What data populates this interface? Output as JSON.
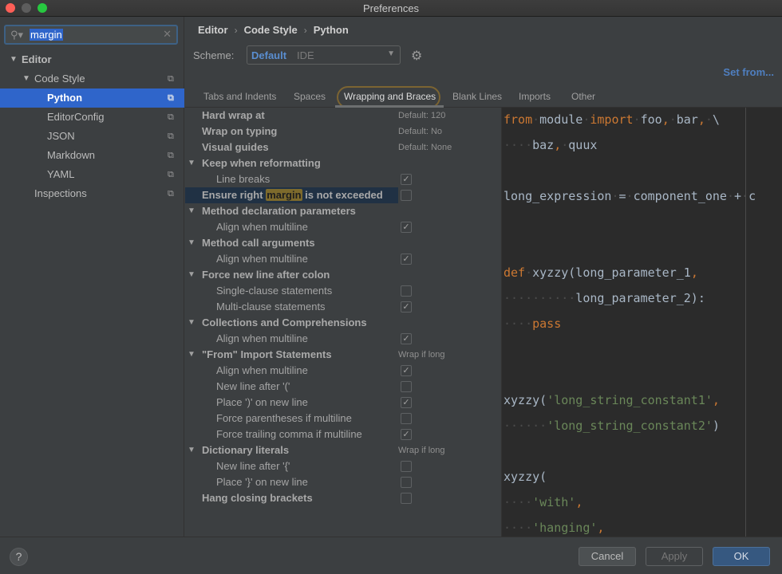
{
  "window": {
    "title": "Preferences"
  },
  "sidebar": {
    "search": {
      "value": "margin",
      "icon": "search-icon",
      "clear_icon": "clear-icon"
    },
    "items": [
      {
        "label": "Editor",
        "level": 0,
        "expanded": true,
        "bold": true
      },
      {
        "label": "Code Style",
        "level": 1,
        "expanded": true
      },
      {
        "label": "Python",
        "level": 2,
        "selected": true
      },
      {
        "label": "EditorConfig",
        "level": 2
      },
      {
        "label": "JSON",
        "level": 2
      },
      {
        "label": "Markdown",
        "level": 2
      },
      {
        "label": "YAML",
        "level": 2
      },
      {
        "label": "Inspections",
        "level": 1
      }
    ]
  },
  "breadcrumb": {
    "items": [
      "Editor",
      "Code Style",
      "Python"
    ],
    "separator": "›"
  },
  "scheme": {
    "label": "Scheme:",
    "name": "Default",
    "sub": "IDE",
    "gear_icon": "gear-icon"
  },
  "set_from": "Set from...",
  "tabs": [
    {
      "label": "Tabs and Indents"
    },
    {
      "label": "Spaces"
    },
    {
      "label": "Wrapping and Braces",
      "active": true
    },
    {
      "label": "Blank Lines"
    },
    {
      "label": "Imports"
    },
    {
      "label": "Other"
    }
  ],
  "settings": {
    "rows": [
      {
        "label": "Hard wrap at",
        "group": true,
        "value": "Default: 120"
      },
      {
        "label": "Wrap on typing",
        "group": true,
        "value": "Default: No"
      },
      {
        "label": "Visual guides",
        "group": true,
        "value": "Default: None"
      },
      {
        "label": "Keep when reformatting",
        "group": true,
        "expandable": true
      },
      {
        "label": "Line breaks",
        "checked": true
      },
      {
        "label_before": "Ensure right ",
        "label_match": "margin",
        "label_after": " is not exceeded",
        "group": true,
        "checked": false,
        "highlighted": true
      },
      {
        "label": "Method declaration parameters",
        "group": true,
        "expandable": true
      },
      {
        "label": "Align when multiline",
        "checked": true
      },
      {
        "label": "Method call arguments",
        "group": true,
        "expandable": true
      },
      {
        "label": "Align when multiline",
        "checked": true
      },
      {
        "label": "Force new line after colon",
        "group": true,
        "expandable": true
      },
      {
        "label": "Single-clause statements",
        "checked": false
      },
      {
        "label": "Multi-clause statements",
        "checked": true
      },
      {
        "label": "Collections and Comprehensions",
        "group": true,
        "expandable": true
      },
      {
        "label": "Align when multiline",
        "checked": true
      },
      {
        "label": "\"From\" Import Statements",
        "group": true,
        "expandable": true,
        "value": "Wrap if long"
      },
      {
        "label": "Align when multiline",
        "checked": true
      },
      {
        "label": "New line after '('",
        "checked": false
      },
      {
        "label": "Place ')' on new line",
        "checked": true
      },
      {
        "label": "Force parentheses if multiline",
        "checked": false
      },
      {
        "label": "Force trailing comma if multiline",
        "checked": true
      },
      {
        "label": "Dictionary literals",
        "group": true,
        "expandable": true,
        "value": "Wrap if long"
      },
      {
        "label": "New line after '{'",
        "checked": false
      },
      {
        "label": "Place '}' on new line",
        "checked": false
      },
      {
        "label": "Hang closing brackets",
        "group": true,
        "checked": false
      }
    ]
  },
  "preview": {
    "lines": [
      [
        {
          "t": "from",
          "c": "kw"
        },
        {
          "t": "·",
          "c": "ws"
        },
        {
          "t": "module"
        },
        {
          "t": "·",
          "c": "ws"
        },
        {
          "t": "import",
          "c": "kw"
        },
        {
          "t": "·",
          "c": "ws"
        },
        {
          "t": "foo"
        },
        {
          "t": ",",
          "c": "kw"
        },
        {
          "t": "·",
          "c": "ws"
        },
        {
          "t": "bar"
        },
        {
          "t": ",",
          "c": "kw"
        },
        {
          "t": "·",
          "c": "ws"
        },
        {
          "t": "\\"
        }
      ],
      [
        {
          "t": "····",
          "c": "ws"
        },
        {
          "t": "baz"
        },
        {
          "t": ",",
          "c": "kw"
        },
        {
          "t": "·",
          "c": "ws"
        },
        {
          "t": "quux"
        }
      ],
      [],
      [
        {
          "t": "long_expression"
        },
        {
          "t": "·",
          "c": "ws"
        },
        {
          "t": "="
        },
        {
          "t": "·",
          "c": "ws"
        },
        {
          "t": "component_one"
        },
        {
          "t": "·",
          "c": "ws"
        },
        {
          "t": "+"
        },
        {
          "t": "·",
          "c": "ws"
        },
        {
          "t": "c"
        }
      ],
      [],
      [],
      [
        {
          "t": "def",
          "c": "kw"
        },
        {
          "t": "·",
          "c": "ws"
        },
        {
          "t": "xyzzy(long_parameter_1"
        },
        {
          "t": ",",
          "c": "kw"
        }
      ],
      [
        {
          "t": "··········",
          "c": "ws"
        },
        {
          "t": "long_parameter_2):"
        }
      ],
      [
        {
          "t": "····",
          "c": "ws"
        },
        {
          "t": "pass",
          "c": "kw"
        }
      ],
      [],
      [],
      [
        {
          "t": "xyzzy("
        },
        {
          "t": "'long_string_constant1'",
          "c": "str"
        },
        {
          "t": ",",
          "c": "kw"
        }
      ],
      [
        {
          "t": "······",
          "c": "ws"
        },
        {
          "t": "'long_string_constant2'",
          "c": "str"
        },
        {
          "t": ")"
        }
      ],
      [],
      [
        {
          "t": "xyzzy("
        }
      ],
      [
        {
          "t": "····",
          "c": "ws"
        },
        {
          "t": "'with'",
          "c": "str"
        },
        {
          "t": ",",
          "c": "kw"
        }
      ],
      [
        {
          "t": "····",
          "c": "ws"
        },
        {
          "t": "'hanging'",
          "c": "str"
        },
        {
          "t": ",",
          "c": "kw"
        }
      ]
    ]
  },
  "footer": {
    "help": "?",
    "cancel": "Cancel",
    "apply": "Apply",
    "ok": "OK"
  }
}
